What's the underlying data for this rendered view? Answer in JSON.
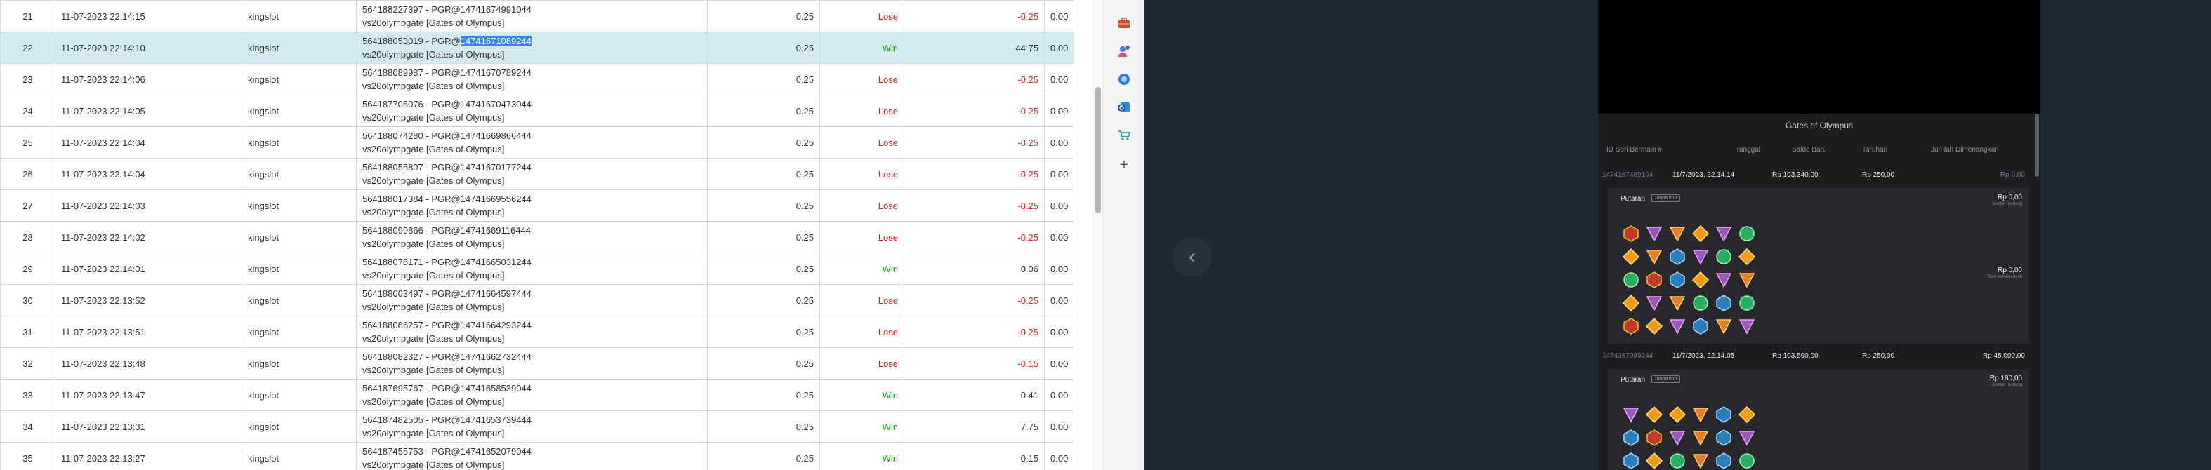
{
  "table": {
    "highlighted_row": 22,
    "highlighted_part": "14741671089244",
    "rows": [
      {
        "no": "21",
        "date": "11-07-2023 22:14:15",
        "user": "kingslot",
        "tx": "564188227397 - PGR@14741674991044",
        "game": "vs20olympgate [Gates of Olympus]",
        "bet": "0.25",
        "result": "Lose",
        "win": "-0.25",
        "jackpot": "0.00"
      },
      {
        "no": "22",
        "date": "11-07-2023 22:14:10",
        "user": "kingslot",
        "tx_prefix": "564188053019 - PGR@",
        "tx_sel": "14741671089244",
        "game": "vs20olympgate [Gates of Olympus]",
        "bet": "0.25",
        "result": "Win",
        "win": "44.75",
        "jackpot": "0.00"
      },
      {
        "no": "23",
        "date": "11-07-2023 22:14:06",
        "user": "kingslot",
        "tx": "564188089987 - PGR@14741670789244",
        "game": "vs20olympgate [Gates of Olympus]",
        "bet": "0.25",
        "result": "Lose",
        "win": "-0.25",
        "jackpot": "0.00"
      },
      {
        "no": "24",
        "date": "11-07-2023 22:14:05",
        "user": "kingslot",
        "tx": "564187705076 - PGR@14741670473044",
        "game": "vs20olympgate [Gates of Olympus]",
        "bet": "0.25",
        "result": "Lose",
        "win": "-0.25",
        "jackpot": "0.00"
      },
      {
        "no": "25",
        "date": "11-07-2023 22:14:04",
        "user": "kingslot",
        "tx": "564188074280 - PGR@14741669866444",
        "game": "vs20olympgate [Gates of Olympus]",
        "bet": "0.25",
        "result": "Lose",
        "win": "-0.25",
        "jackpot": "0.00"
      },
      {
        "no": "26",
        "date": "11-07-2023 22:14:04",
        "user": "kingslot",
        "tx": "564188055807 - PGR@14741670177244",
        "game": "vs20olympgate [Gates of Olympus]",
        "bet": "0.25",
        "result": "Lose",
        "win": "-0.25",
        "jackpot": "0.00"
      },
      {
        "no": "27",
        "date": "11-07-2023 22:14:03",
        "user": "kingslot",
        "tx": "564188017384 - PGR@14741669556244",
        "game": "vs20olympgate [Gates of Olympus]",
        "bet": "0.25",
        "result": "Lose",
        "win": "-0.25",
        "jackpot": "0.00"
      },
      {
        "no": "28",
        "date": "11-07-2023 22:14:02",
        "user": "kingslot",
        "tx": "564188099866 - PGR@14741669116444",
        "game": "vs20olympgate [Gates of Olympus]",
        "bet": "0.25",
        "result": "Lose",
        "win": "-0.25",
        "jackpot": "0.00"
      },
      {
        "no": "29",
        "date": "11-07-2023 22:14:01",
        "user": "kingslot",
        "tx": "564188078171 - PGR@14741665031244",
        "game": "vs20olympgate [Gates of Olympus]",
        "bet": "0.25",
        "result": "Win",
        "win": "0.06",
        "jackpot": "0.00"
      },
      {
        "no": "30",
        "date": "11-07-2023 22:13:52",
        "user": "kingslot",
        "tx": "564188003497 - PGR@14741664597444",
        "game": "vs20olympgate [Gates of Olympus]",
        "bet": "0.25",
        "result": "Lose",
        "win": "-0.25",
        "jackpot": "0.00"
      },
      {
        "no": "31",
        "date": "11-07-2023 22:13:51",
        "user": "kingslot",
        "tx": "564188086257 - PGR@14741664293244",
        "game": "vs20olympgate [Gates of Olympus]",
        "bet": "0.25",
        "result": "Lose",
        "win": "-0.25",
        "jackpot": "0.00"
      },
      {
        "no": "32",
        "date": "11-07-2023 22:13:48",
        "user": "kingslot",
        "tx": "564188082327 - PGR@14741662732444",
        "game": "vs20olympgate [Gates of Olympus]",
        "bet": "0.25",
        "result": "Lose",
        "win": "-0.15",
        "jackpot": "0.00"
      },
      {
        "no": "33",
        "date": "11-07-2023 22:13:47",
        "user": "kingslot",
        "tx": "564187695767 - PGR@14741658539044",
        "game": "vs20olympgate [Gates of Olympus]",
        "bet": "0.25",
        "result": "Win",
        "win": "0.41",
        "jackpot": "0.00"
      },
      {
        "no": "34",
        "date": "11-07-2023 22:13:31",
        "user": "kingslot",
        "tx": "564187482505 - PGR@14741653739444",
        "game": "vs20olympgate [Gates of Olympus]",
        "bet": "0.25",
        "result": "Win",
        "win": "7.75",
        "jackpot": "0.00"
      },
      {
        "no": "35",
        "date": "11-07-2023 22:13:27",
        "user": "kingslot",
        "tx": "564187455753 - PGR@14741652079044",
        "game": "vs20olympgate [Gates of Olympus]",
        "bet": "0.25",
        "result": "Win",
        "win": "0.15",
        "jackpot": "0.00"
      }
    ]
  },
  "colors": {
    "lose": "#e0201b",
    "win": "#14a014",
    "highlight_row": "#d3eaf0",
    "selection": "#3b84f5",
    "dark_bg": "#1e2a33"
  },
  "sidebar_icons": [
    "toolbox-icon",
    "user-chat-icon",
    "copilot-icon",
    "outlook-icon",
    "shopping-icon",
    "plus-icon"
  ],
  "history": {
    "title": "Gates of Olympus",
    "headers": {
      "round_id": "ID Seri Bermain #",
      "date": "Tanggal",
      "balance": "Saldo Baru",
      "bet": "Taruhan",
      "win": "Jumlah Dimenangkan"
    },
    "rounds": [
      {
        "id": "1474167499104",
        "date": "11/7/2023, 22.14.14",
        "balance": "Rp 103.340,00",
        "bet": "Rp 250,00",
        "win": "Rp 0,00",
        "spin_label": "Putaran",
        "spin_tag": "Tanpa fitur",
        "spin_amount": "Rp 0,00",
        "spin_amount_sub": "Jumlah menang",
        "total_amount": "Rp 0,00",
        "total_sub": "Total kemenangan"
      },
      {
        "id": "1474167089244",
        "date": "11/7/2023, 22.14.05",
        "balance": "Rp 103.590,00",
        "bet": "Rp 250,00",
        "win": "Rp 45.000,00",
        "spin_label": "Putaran",
        "spin_tag": "Tanpa fitur",
        "spin_amount": "Rp 180,00",
        "spin_amount_sub": "Jumlah menang"
      }
    ]
  }
}
